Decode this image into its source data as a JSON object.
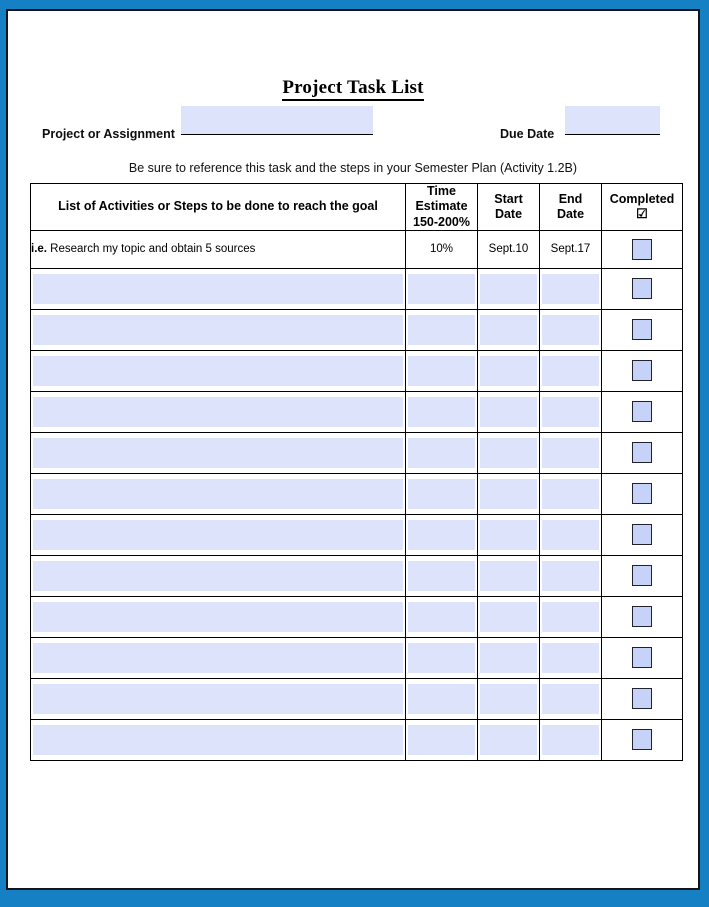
{
  "document": {
    "title": "Project Task List",
    "subtitle": "Be sure to reference this task and the steps in your Semester Plan (Activity 1.2B)"
  },
  "fields": {
    "project": {
      "label": "Project or Assignment",
      "value": "",
      "placeholder": ""
    },
    "due_date": {
      "label": "Due Date",
      "value": "",
      "placeholder": ""
    }
  },
  "table": {
    "headers": {
      "activity": "List of Activities or Steps to be done to reach the goal",
      "time_line1": "Time",
      "time_line2": "Estimate",
      "time_line3": "150-200%",
      "start_line1": "Start",
      "start_line2": "Date",
      "end_line1": "End",
      "end_line2": "Date",
      "completed": "Completed",
      "completed_icon": "checked-box-glyph"
    },
    "example_row": {
      "prefix": "i.e.",
      "activity": " Research my topic and obtain 5 sources",
      "time_estimate": "10%",
      "start_date": "Sept.10",
      "end_date": "Sept.17",
      "completed": ""
    },
    "blank_row_count": 12,
    "blank_row": {
      "activity": "",
      "time_estimate": "",
      "start_date": "",
      "end_date": "",
      "completed": ""
    }
  },
  "colors": {
    "page_border": "#1580c4",
    "field_fill": "#dde3fa",
    "checkbox_fill": "#c6d2f7",
    "checkbox_border": "#20232e",
    "rule": "#000000"
  }
}
